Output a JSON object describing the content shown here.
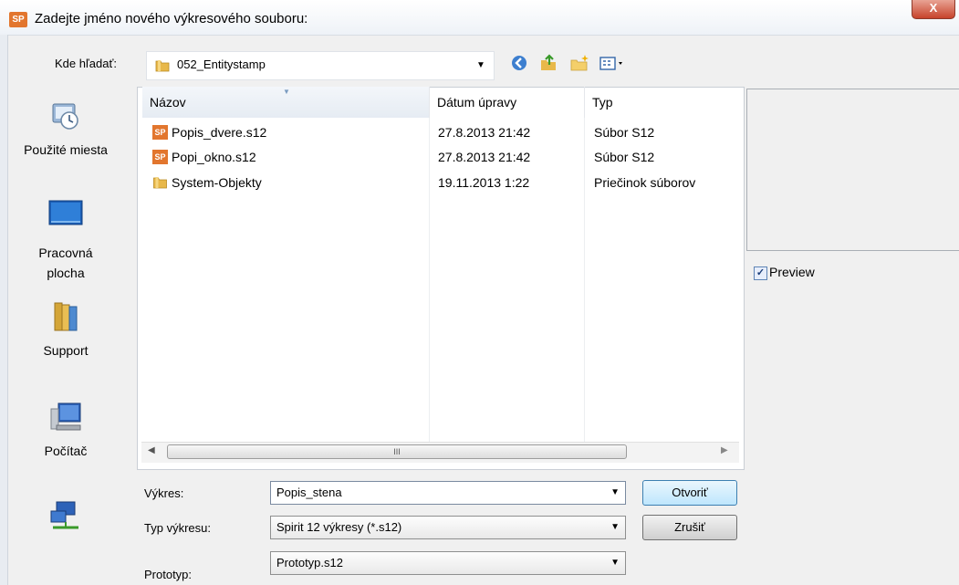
{
  "window": {
    "app_icon_text": "SP",
    "title": "Zadejte jméno nového výkresového souboru:",
    "close_label": "X"
  },
  "lookin": {
    "label": "Kde hľadať:",
    "value": "052_Entitystamp"
  },
  "toolbar_icons": [
    "back-icon",
    "up-folder-icon",
    "new-folder-icon",
    "view-menu-icon"
  ],
  "places": [
    {
      "label": "Použité miesta",
      "icon": "recent-places-icon"
    },
    {
      "label": "Pracovná plocha",
      "icon": "desktop-icon"
    },
    {
      "label": "Support",
      "icon": "library-icon"
    },
    {
      "label": "Počítač",
      "icon": "computer-icon"
    },
    {
      "label": "",
      "icon": "network-icon"
    }
  ],
  "columns": {
    "name": "Názov",
    "date": "Dátum úpravy",
    "type": "Typ"
  },
  "files": [
    {
      "icon": "SP",
      "name": "Popis_dvere.s12",
      "date": "27.8.2013 21:42",
      "type": "Súbor S12"
    },
    {
      "icon": "SP",
      "name": "Popi_okno.s12",
      "date": "27.8.2013 21:42",
      "type": "Súbor S12"
    },
    {
      "icon": "folder",
      "name": "System-Objekty",
      "date": "19.11.2013 1:22",
      "type": "Priečinok súborov"
    }
  ],
  "scrollbar": {
    "thumb_grip": "III"
  },
  "preview": {
    "label": "Preview",
    "checked": true,
    "check_mark": "✓"
  },
  "form": {
    "drawing_label": "Výkres:",
    "drawing_value": "Popis_stena",
    "type_label": "Typ výkresu:",
    "type_value": "Spirit 12 výkresy (*.s12)",
    "prototype_label": "Prototyp:",
    "prototype_value": "Prototyp.s12"
  },
  "buttons": {
    "open": "Otvoriť",
    "cancel": "Zrušiť"
  },
  "colors": {
    "accent": "#e2762e",
    "folder": "#e8b84a",
    "selection": "#bee6fd"
  }
}
